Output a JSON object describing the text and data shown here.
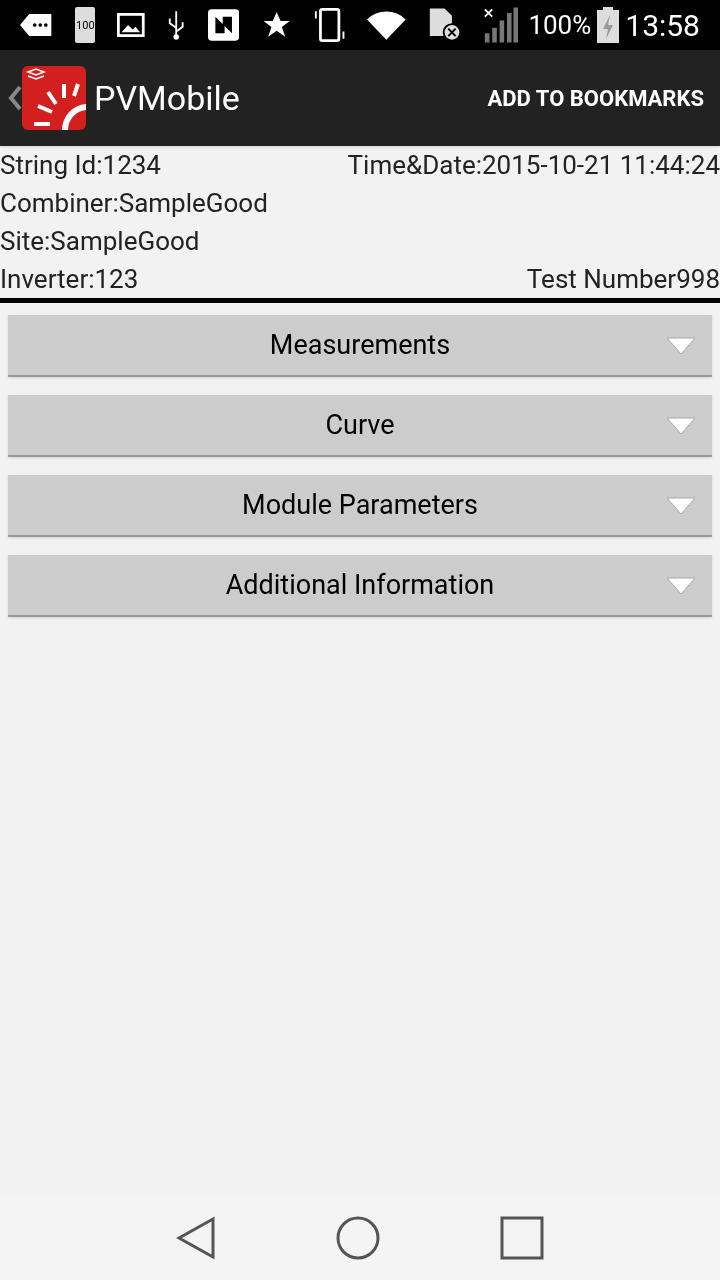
{
  "status_bar": {
    "battery_saver_label": "100",
    "battery_percent": "100%",
    "time": "13:58"
  },
  "app_bar": {
    "title": "PVMobile",
    "action": "ADD TO BOOKMARKS"
  },
  "info": {
    "string_id": "String Id:1234",
    "time_date": "Time&Date:2015-10-21 11:44:24",
    "combiner": "Combiner:SampleGood",
    "site": "Site:SampleGood",
    "inverter": "Inverter:123",
    "test_number": "Test Number998"
  },
  "sections": [
    {
      "label": "Measurements",
      "expanded": false
    },
    {
      "label": "Curve",
      "expanded": false
    },
    {
      "label": "Module Parameters",
      "expanded": false
    },
    {
      "label": "Additional Information",
      "expanded": false
    }
  ]
}
